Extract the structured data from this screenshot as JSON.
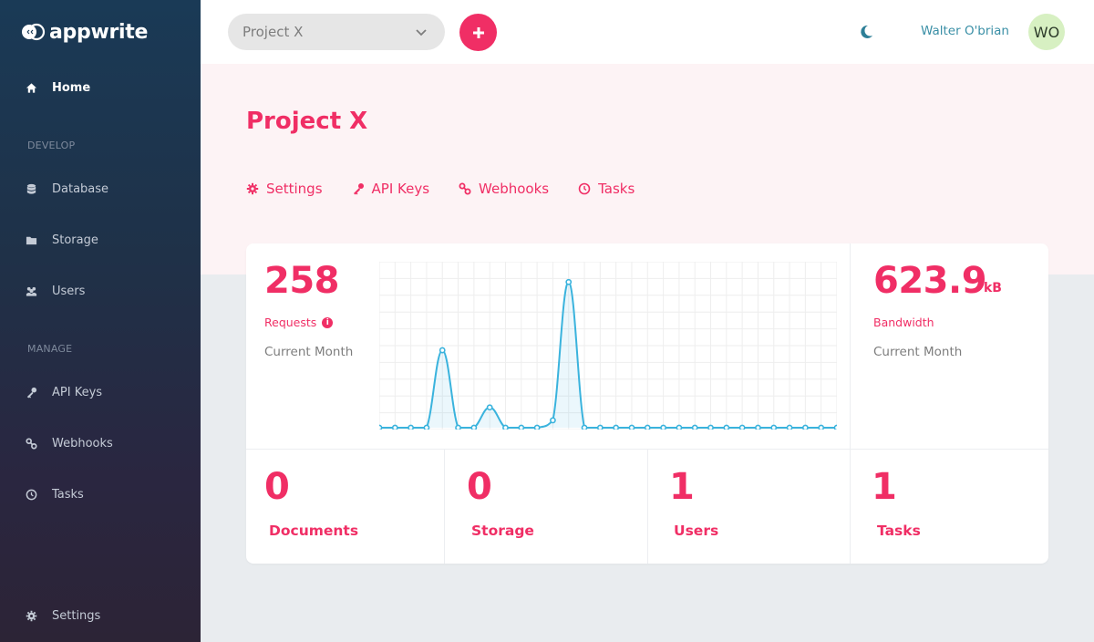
{
  "app": {
    "logo_text": "appwrite"
  },
  "sidebar": {
    "home": "Home",
    "section_develop": "DEVELOP",
    "develop_items": [
      "Database",
      "Storage",
      "Users"
    ],
    "section_manage": "MANAGE",
    "manage_items": [
      "API Keys",
      "Webhooks",
      "Tasks"
    ],
    "settings": "Settings"
  },
  "topbar": {
    "project_select_value": "Project X",
    "user_name": "Walter O'brian",
    "avatar_initials": "WO"
  },
  "header": {
    "title": "Project X",
    "tabs": [
      "Settings",
      "API Keys",
      "Webhooks",
      "Tasks"
    ]
  },
  "stats": {
    "requests": {
      "value": "258",
      "label": "Requests",
      "period": "Current Month"
    },
    "bandwidth": {
      "value": "623.9",
      "unit": "kB",
      "label": "Bandwidth",
      "period": "Current Month"
    },
    "documents": {
      "value": "0",
      "label": "Documents"
    },
    "storage": {
      "value": "0",
      "label": "Storage"
    },
    "users": {
      "value": "1",
      "label": "Users"
    },
    "tasks": {
      "value": "1",
      "label": "Tasks"
    }
  },
  "chart_data": {
    "type": "line",
    "title": "",
    "xlabel": "",
    "ylabel": "",
    "grid": true,
    "x": [
      1,
      2,
      3,
      4,
      5,
      6,
      7,
      8,
      9,
      10,
      11,
      12,
      13,
      14,
      15,
      16,
      17,
      18,
      19,
      20,
      21,
      22,
      23,
      24,
      25,
      26,
      27,
      28,
      29,
      30
    ],
    "series": [
      {
        "values": [
          0,
          0,
          0,
          0,
          84,
          0,
          0,
          22,
          0,
          0,
          0,
          8,
          158,
          0,
          0,
          0,
          0,
          0,
          0,
          0,
          0,
          0,
          0,
          0,
          0,
          0,
          0,
          0,
          0,
          0
        ]
      }
    ],
    "ylim": [
      0,
      180
    ],
    "color": "#3ab3dd"
  },
  "colors": {
    "accent": "#f02e65",
    "user_link": "#3a8fa6",
    "chart_line": "#3ab3dd"
  }
}
